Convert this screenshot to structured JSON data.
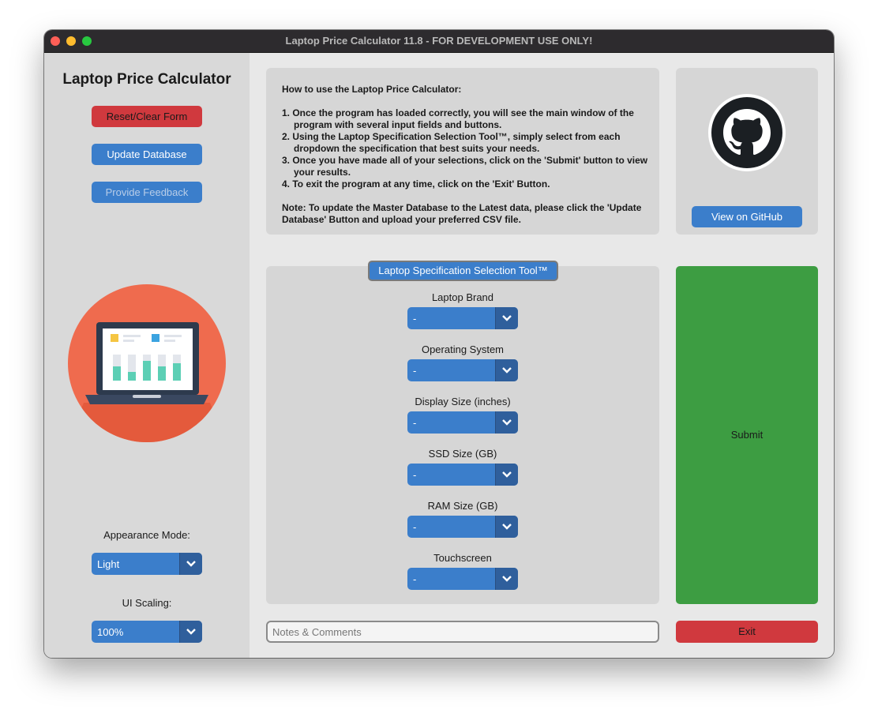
{
  "window": {
    "title": "Laptop Price Calculator 11.8 - FOR DEVELOPMENT USE ONLY!"
  },
  "sidebar": {
    "app_title": "Laptop Price Calculator",
    "reset_label": "Reset/Clear Form",
    "update_db_label": "Update Database",
    "feedback_label": "Provide Feedback",
    "logo_icon": "laptop-dashboard-icon",
    "appearance_label": "Appearance Mode:",
    "appearance_value": "Light",
    "scaling_label": "UI Scaling:",
    "scaling_value": "100%"
  },
  "instructions": {
    "heading": "How to use the Laptop Price Calculator:",
    "steps": [
      "1. Once the program has loaded correctly, you will see the main window of the program with several input fields and buttons.",
      "2. Using the Laptop Specification Selection Tool™, simply select from each dropdown the specification that best suits your needs.",
      "3. Once you have made all of your selections, click on the 'Submit' button to view your results.",
      "4. To exit the program at any time, click on the 'Exit' Button."
    ],
    "note": "Note: To update the Master Database to the Latest data, please click the 'Update Database' Button and upload your preferred CSV file."
  },
  "github": {
    "icon": "github-icon",
    "button_label": "View on GitHub"
  },
  "spec_tool": {
    "tab_label": "Laptop Specification Selection Tool™",
    "fields": [
      {
        "label": "Laptop Brand",
        "value": "-"
      },
      {
        "label": "Operating System",
        "value": "-"
      },
      {
        "label": "Display Size (inches)",
        "value": "-"
      },
      {
        "label": "SSD Size (GB)",
        "value": "-"
      },
      {
        "label": "RAM Size (GB)",
        "value": "-"
      },
      {
        "label": "Touchscreen",
        "value": "-"
      }
    ]
  },
  "actions": {
    "submit_label": "Submit",
    "exit_label": "Exit",
    "notes_placeholder": "Notes & Comments"
  },
  "colors": {
    "accent_blue": "#3b7ecb",
    "danger_red": "#d0393e",
    "submit_green": "#3d9d42"
  }
}
